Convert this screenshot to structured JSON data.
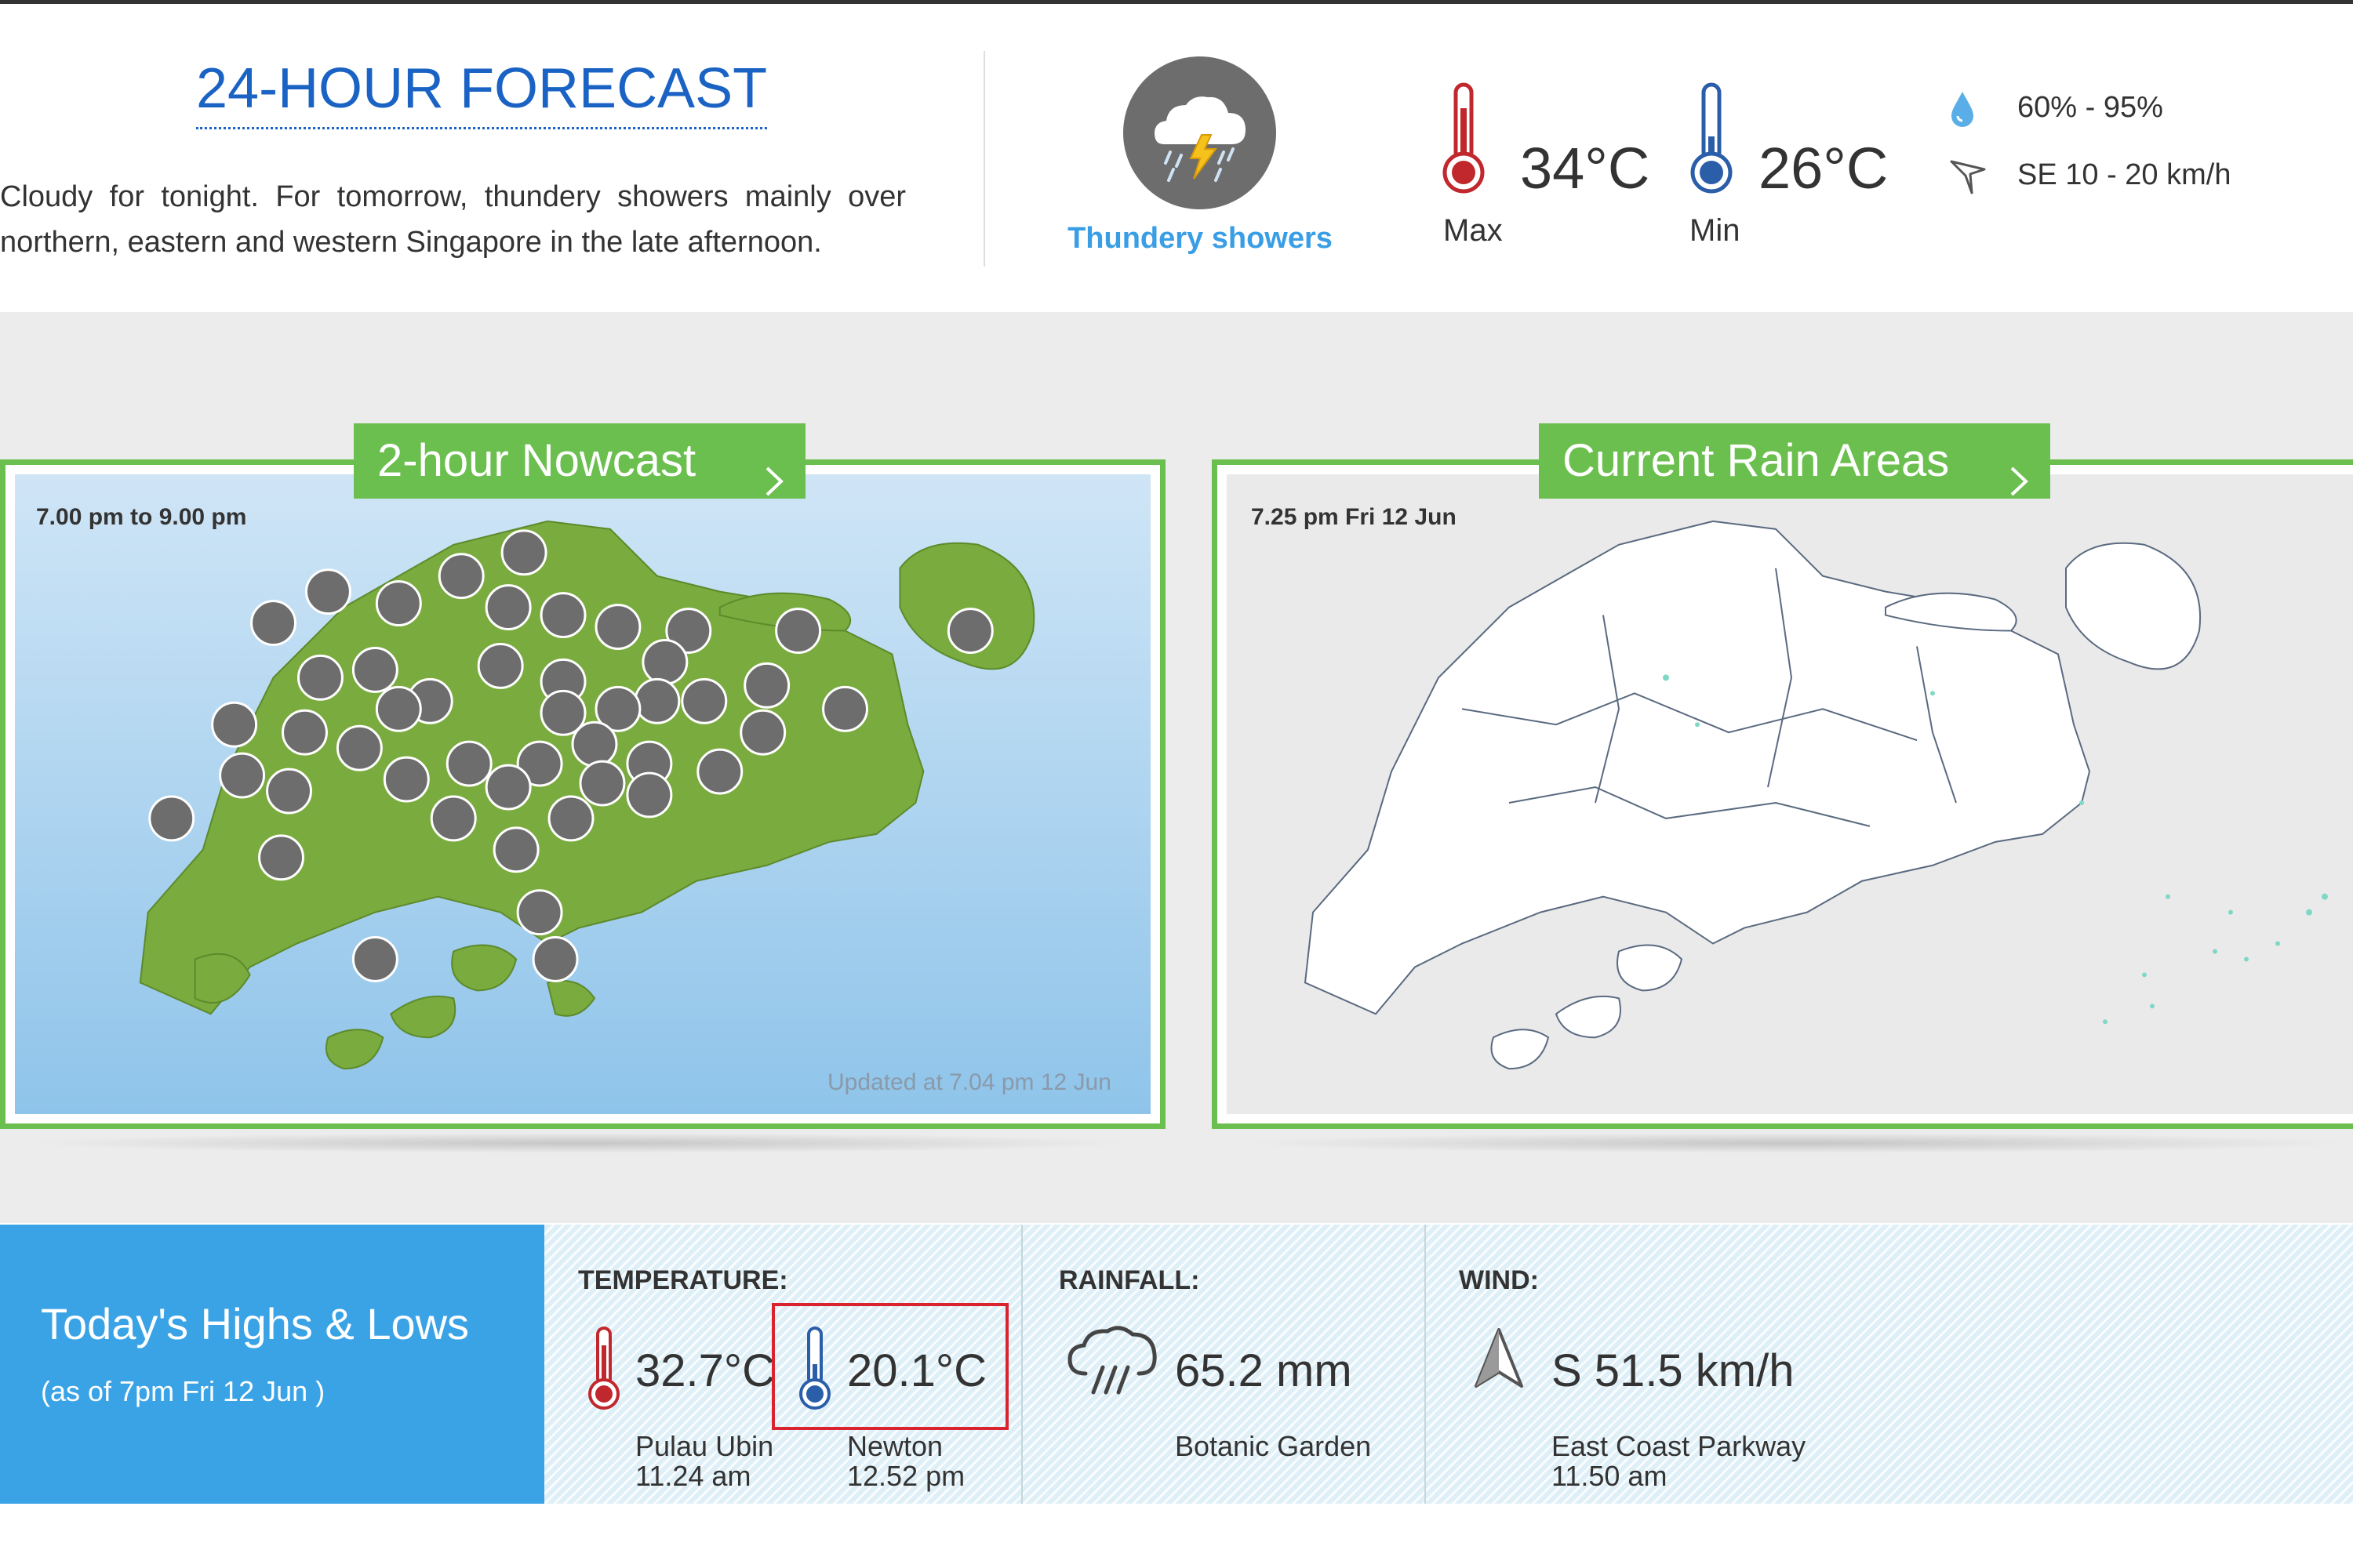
{
  "forecast": {
    "title": "24-HOUR FORECAST",
    "description": "Cloudy for tonight. For tomorrow, thundery showers mainly over northern, eastern and western Singapore in the late afternoon.",
    "condition": "Thundery showers",
    "condition_icon": "thundery-showers-icon",
    "max_temp": "34°C",
    "max_label": "Max",
    "min_temp": "26°C",
    "min_label": "Min",
    "humidity": "60% - 95%",
    "wind": "SE 10 - 20 km/h"
  },
  "nowcast": {
    "tab_label": "2-hour Nowcast",
    "time_range": "7.00 pm to 9.00 pm",
    "updated": "Updated at 7.04 pm 12 Jun"
  },
  "rain_areas": {
    "tab_label": "Current Rain Areas",
    "timestamp": "7.25 pm Fri 12 Jun"
  },
  "highs_lows": {
    "title": "Today's Highs & Lows",
    "subtitle": "(as of 7pm Fri 12 Jun )",
    "temperature": {
      "heading": "TEMPERATURE:",
      "high_value": "32.7°C",
      "high_location": "Pulau Ubin",
      "high_time": "11.24 am",
      "low_value": "20.1°C",
      "low_location": "Newton",
      "low_time": "12.52 pm"
    },
    "rainfall": {
      "heading": "RAINFALL:",
      "value": "65.2 mm",
      "location": "Botanic Garden"
    },
    "wind": {
      "heading": "WIND:",
      "value": "S 51.5 km/h",
      "location": "East Coast Parkway",
      "time": "11.50 am"
    }
  },
  "colors": {
    "accent_blue": "#1a63c4",
    "condition_blue": "#3a9ee4",
    "panel_green": "#6bbf4e",
    "highs_lows_blue": "#3aa3e6",
    "max_red": "#c0282e",
    "min_blue": "#2a5ea8",
    "highlight_red": "#d9242f"
  }
}
